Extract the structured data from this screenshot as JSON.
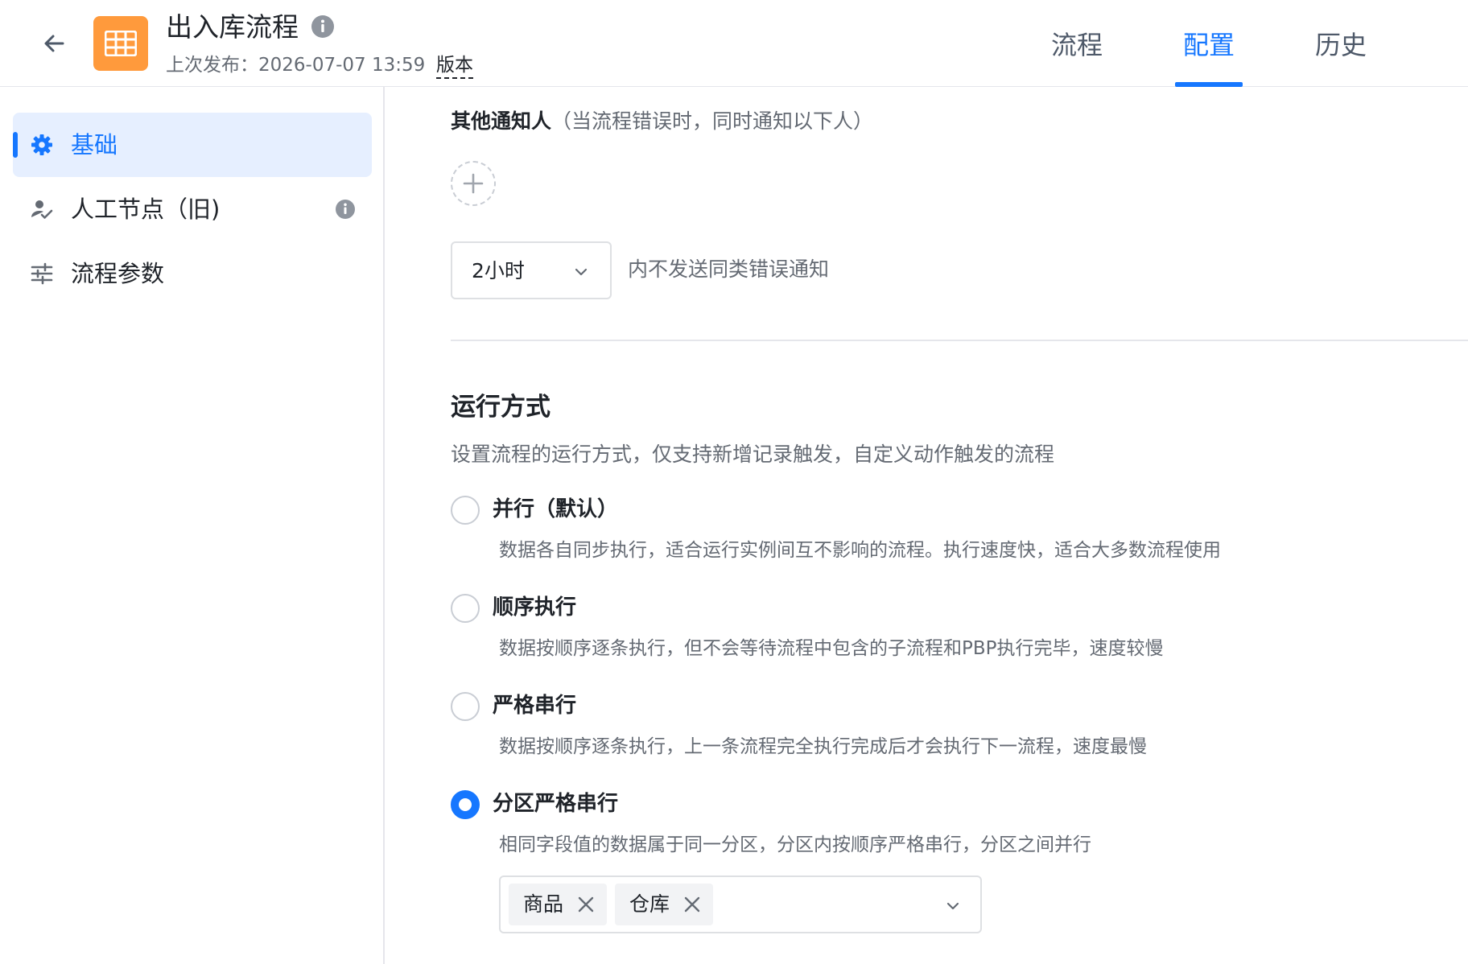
{
  "header": {
    "title": "出入库流程",
    "publish_info": "上次发布：2026-07-07 13:59",
    "version_link": "版本",
    "tabs": [
      {
        "label": "流程",
        "active": false
      },
      {
        "label": "配置",
        "active": true
      },
      {
        "label": "历史",
        "active": false
      }
    ]
  },
  "sidebar": {
    "items": [
      {
        "label": "基础",
        "icon": "gear-icon",
        "active": true
      },
      {
        "label": "人工节点（旧)",
        "icon": "user-check-icon",
        "active": false
      },
      {
        "label": "流程参数",
        "icon": "sliders-icon",
        "active": false
      }
    ]
  },
  "main": {
    "notify": {
      "title": "其他通知人",
      "subtitle": "（当流程错误时，同时通知以下人）"
    },
    "interval": {
      "value": "2小时",
      "suffix": "内不发送同类错误通知"
    },
    "run_mode": {
      "title": "运行方式",
      "description": "设置流程的运行方式，仅支持新增记录触发，自定义动作触发的流程",
      "options": [
        {
          "label": "并行（默认）",
          "desc": "数据各自同步执行，适合运行实例间互不影响的流程。执行速度快，适合大多数流程使用",
          "checked": false
        },
        {
          "label": "顺序执行",
          "desc": "数据按顺序逐条执行，但不会等待流程中包含的子流程和PBP执行完毕，速度较慢",
          "checked": false
        },
        {
          "label": "严格串行",
          "desc": "数据按顺序逐条执行，上一条流程完全执行完成后才会执行下一流程，速度最慢",
          "checked": false
        },
        {
          "label": "分区严格串行",
          "desc": "相同字段值的数据属于同一分区，分区内按顺序严格串行，分区之间并行",
          "checked": true
        }
      ],
      "partition_fields": [
        "商品",
        "仓库"
      ]
    }
  },
  "colors": {
    "accent": "#1677ff",
    "app_icon": "#ff9a3c",
    "active_bg": "#e6efff"
  }
}
